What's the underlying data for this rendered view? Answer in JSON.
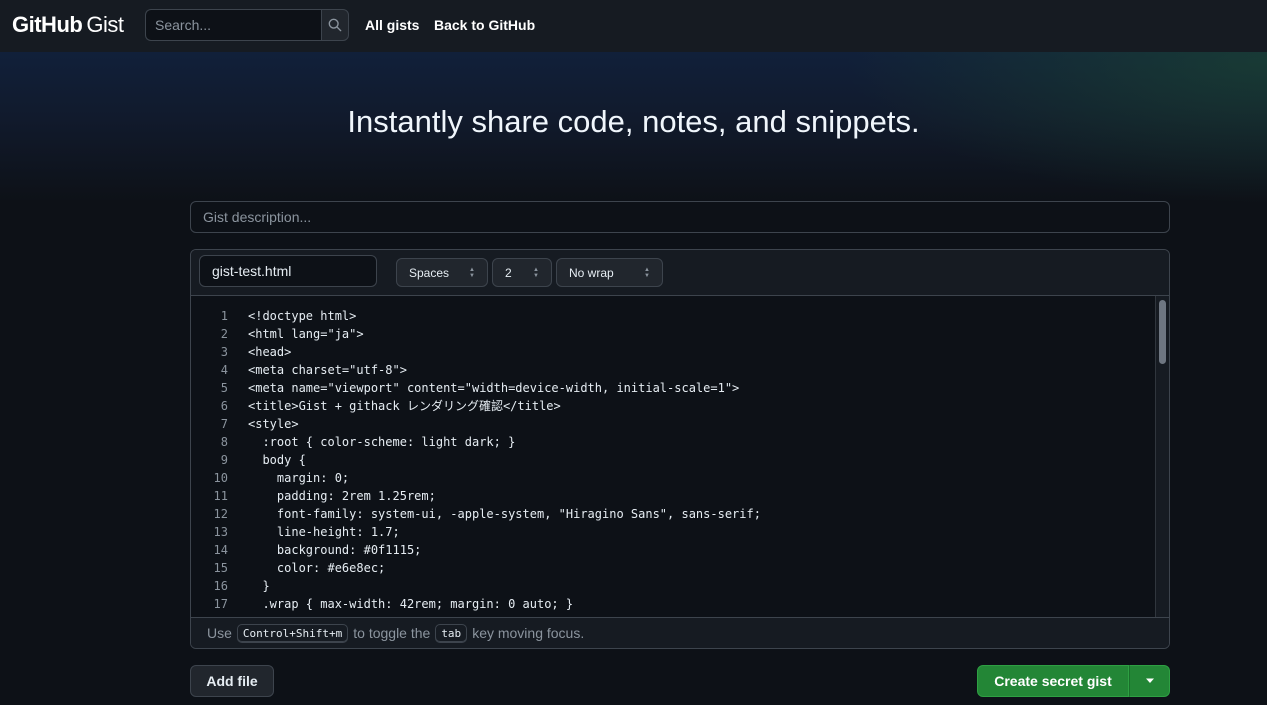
{
  "header": {
    "logo_brand": "GitHub",
    "logo_product": "Gist",
    "search_placeholder": "Search...",
    "nav": [
      "All gists",
      "Back to GitHub"
    ]
  },
  "hero": {
    "title": "Instantly share code, notes, and snippets."
  },
  "description": {
    "placeholder": "Gist description..."
  },
  "file": {
    "filename": "gist-test.html",
    "indent_mode": "Spaces",
    "indent_size": "2",
    "wrap_mode": "No wrap",
    "lines": [
      {
        "n": "1",
        "text": "<!doctype html>"
      },
      {
        "n": "2",
        "text": "<html lang=\"ja\">"
      },
      {
        "n": "3",
        "text": "<head>"
      },
      {
        "n": "4",
        "text": "<meta charset=\"utf-8\">"
      },
      {
        "n": "5",
        "text": "<meta name=\"viewport\" content=\"width=device-width, initial-scale=1\">"
      },
      {
        "n": "6",
        "text": "<title>Gist + githack レンダリング確認</title>"
      },
      {
        "n": "7",
        "text": "<style>"
      },
      {
        "n": "8",
        "text": "  :root { color-scheme: light dark; }"
      },
      {
        "n": "9",
        "text": "  body {"
      },
      {
        "n": "10",
        "text": "    margin: 0;"
      },
      {
        "n": "11",
        "text": "    padding: 2rem 1.25rem;"
      },
      {
        "n": "12",
        "text": "    font-family: system-ui, -apple-system, \"Hiragino Sans\", sans-serif;"
      },
      {
        "n": "13",
        "text": "    line-height: 1.7;"
      },
      {
        "n": "14",
        "text": "    background: #0f1115;"
      },
      {
        "n": "15",
        "text": "    color: #e6e8ec;"
      },
      {
        "n": "16",
        "text": "  }"
      },
      {
        "n": "17",
        "text": "  .wrap { max-width: 42rem; margin: 0 auto; }"
      }
    ],
    "footer": {
      "prefix": "Use",
      "shortcut": "Control+Shift+m",
      "middle": "to toggle the",
      "key": "tab",
      "suffix": "key moving focus."
    }
  },
  "actions": {
    "add_file": "Add file",
    "create": "Create secret gist"
  },
  "colors": {
    "background": "#0d1117",
    "header": "#161b22",
    "primary_button": "#238636",
    "border": "#3d444d"
  }
}
